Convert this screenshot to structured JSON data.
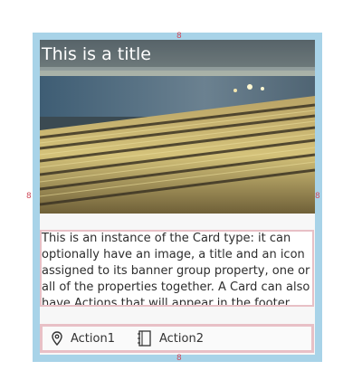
{
  "card": {
    "title": "This is a title",
    "description": "This is an instance of the Card type: it can optionally have an image, a title and an icon assigned to its banner group property, one or all of the properties together. A Card can also have Actions that will appear in the footer.",
    "actions": [
      {
        "label": "Action1",
        "icon": "location-pin-icon"
      },
      {
        "label": "Action2",
        "icon": "notebook-icon"
      }
    ]
  },
  "guides": {
    "top": "8",
    "left": "8",
    "right": "8",
    "bottom": "8"
  },
  "colors": {
    "margin_guide": "#a8d3e8",
    "padding_guide": "#e8c0c6",
    "guide_text": "#cf4a5a"
  }
}
